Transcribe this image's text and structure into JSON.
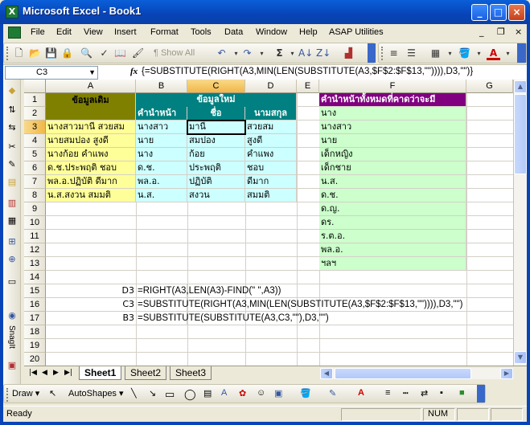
{
  "window": {
    "title": "Microsoft Excel - Book1"
  },
  "menu": [
    "File",
    "Edit",
    "View",
    "Insert",
    "Format",
    "Tools",
    "Data",
    "Window",
    "Help",
    "ASAP Utilities"
  ],
  "mdi": {
    "min": "_",
    "restore": "❐",
    "close": "×"
  },
  "toolbar": {
    "show_all": "Show All",
    "zoom_hint": ""
  },
  "formula_bar": {
    "name_box": "C3",
    "fx": "fx",
    "formula": "{=SUBSTITUTE(RIGHT(A3,MIN(LEN(SUBSTITUTE(A3,$F$2:$F$13,\"\")))),D3,\"\")}"
  },
  "columns": [
    "A",
    "B",
    "C",
    "D",
    "E",
    "F",
    "G"
  ],
  "rows": [
    "1",
    "2",
    "3",
    "4",
    "5",
    "6",
    "7",
    "8",
    "9",
    "10",
    "11",
    "12",
    "13",
    "14",
    "15",
    "16",
    "17",
    "18",
    "19",
    "20"
  ],
  "cells": {
    "A1": "ข้อมูลเดิม",
    "B1C1D1": "ข้อมูลใหม่",
    "B2": "คำนำหน้า",
    "C2": "ชื่อ",
    "D2": "นามสกุล",
    "F1": "คำนำหน้าทั้งหมดที่คาดว่าจะมี",
    "A": [
      "นางสาวมานี สวยสม",
      "นายสมปอง สูงดี",
      "นางก้อย คำแพง",
      "ด.ช.ประพฤติ ชอบ",
      "พล.อ.ปฏิบัติ ดีมาก",
      "น.ส.สงวน สมมติ"
    ],
    "B": [
      "นางสาว",
      "นาย",
      "นาง",
      "ด.ช.",
      "พล.อ.",
      "น.ส."
    ],
    "C": [
      "มานี",
      "สมปอง",
      "ก้อย",
      "ประพฤติ",
      "ปฏิบัติ",
      "สงวน"
    ],
    "D": [
      "สวยสม",
      "สูงดี",
      "คำแพง",
      "ชอบ",
      "ดีมาก",
      "สมมติ"
    ],
    "F": [
      "นาง",
      "นางสาว",
      "นาย",
      "เด็กหญิง",
      "เด็กชาย",
      "น.ส.",
      "ด.ช.",
      "ด.ญ.",
      "ดร.",
      "ร.ต.อ.",
      "พล.อ.",
      "ฯลฯ"
    ],
    "notes": [
      {
        "label": "D3",
        "formula": "=RIGHT(A3,LEN(A3)-FIND(\" \",A3))"
      },
      {
        "label": "C3",
        "formula": "=SUBSTITUTE(RIGHT(A3,MIN(LEN(SUBSTITUTE(A3,$F$2:$F$13,\"\")))),D3,\"\")"
      },
      {
        "label": "B3",
        "formula": "=SUBSTITUTE(SUBSTITUTE(A3,C3,\"\"),D3,\"\")"
      }
    ]
  },
  "colors": {
    "header_olive": "#808000",
    "header_teal": "#008080",
    "header_purple": "#800080",
    "fill_yellow": "#ffff99",
    "fill_cyan": "#ccffff",
    "fill_green": "#ccffcc"
  },
  "sheets": [
    "Sheet1",
    "Sheet2",
    "Sheet3"
  ],
  "draw_toolbar": {
    "draw": "Draw ▾",
    "autoshapes": "AutoShapes ▾"
  },
  "status": {
    "left": "Ready",
    "num": "NUM"
  }
}
